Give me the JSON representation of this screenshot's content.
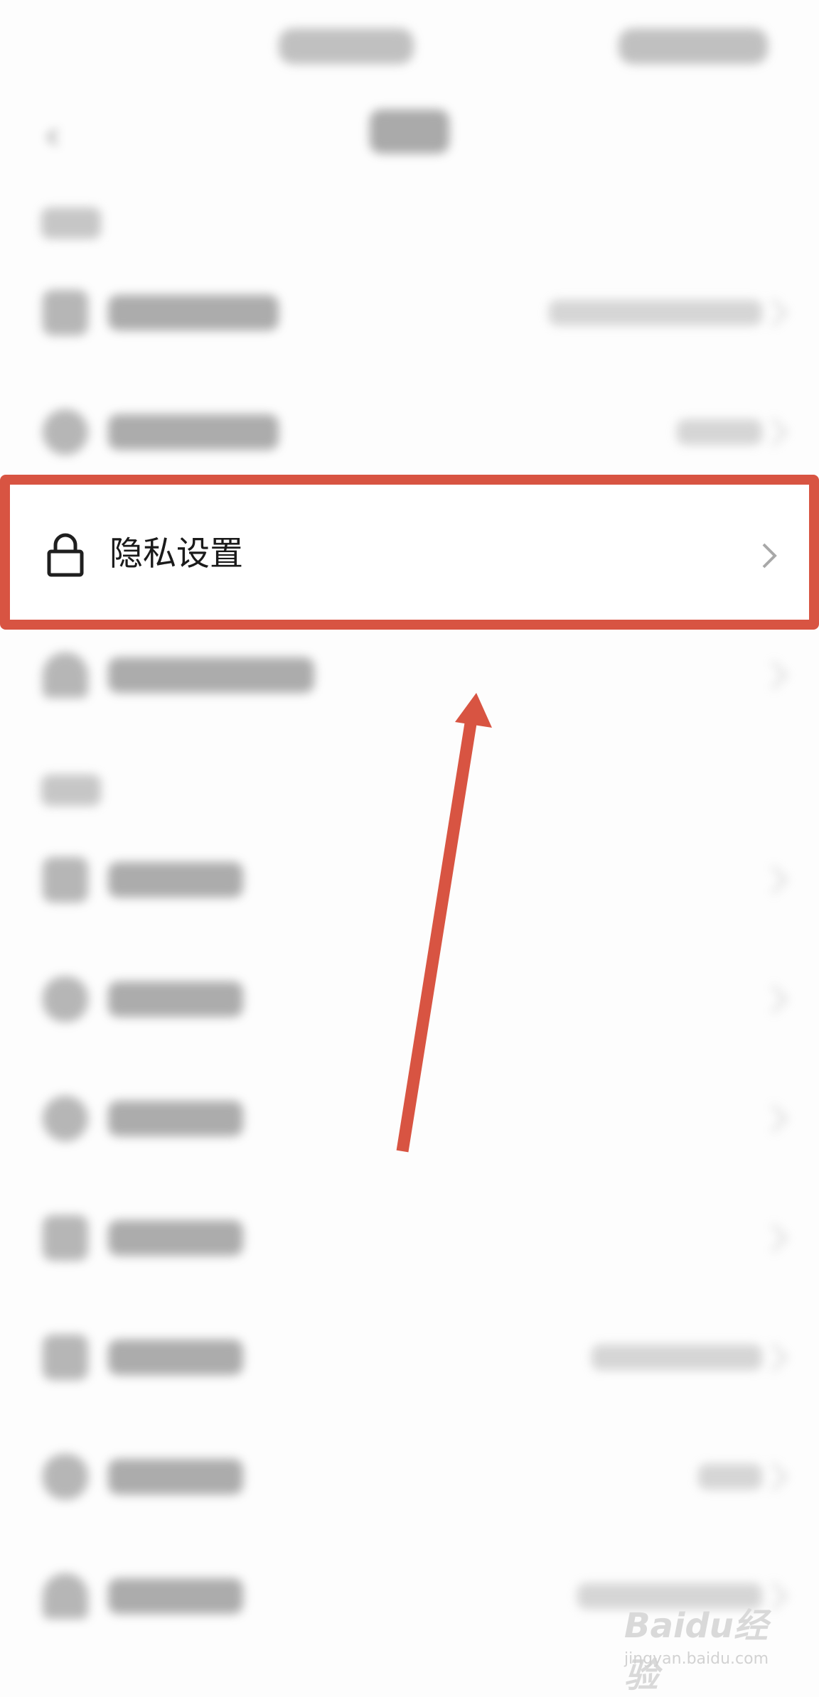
{
  "privacy_row": {
    "label": "隐私设置",
    "icon": "lock-icon",
    "chevron_icon": "chevron-right-icon"
  },
  "watermark": {
    "brand": "Baidu经验",
    "url": "jingyan.baidu.com"
  },
  "colors": {
    "highlight": "#d85442",
    "background": "#fdfdfd"
  }
}
